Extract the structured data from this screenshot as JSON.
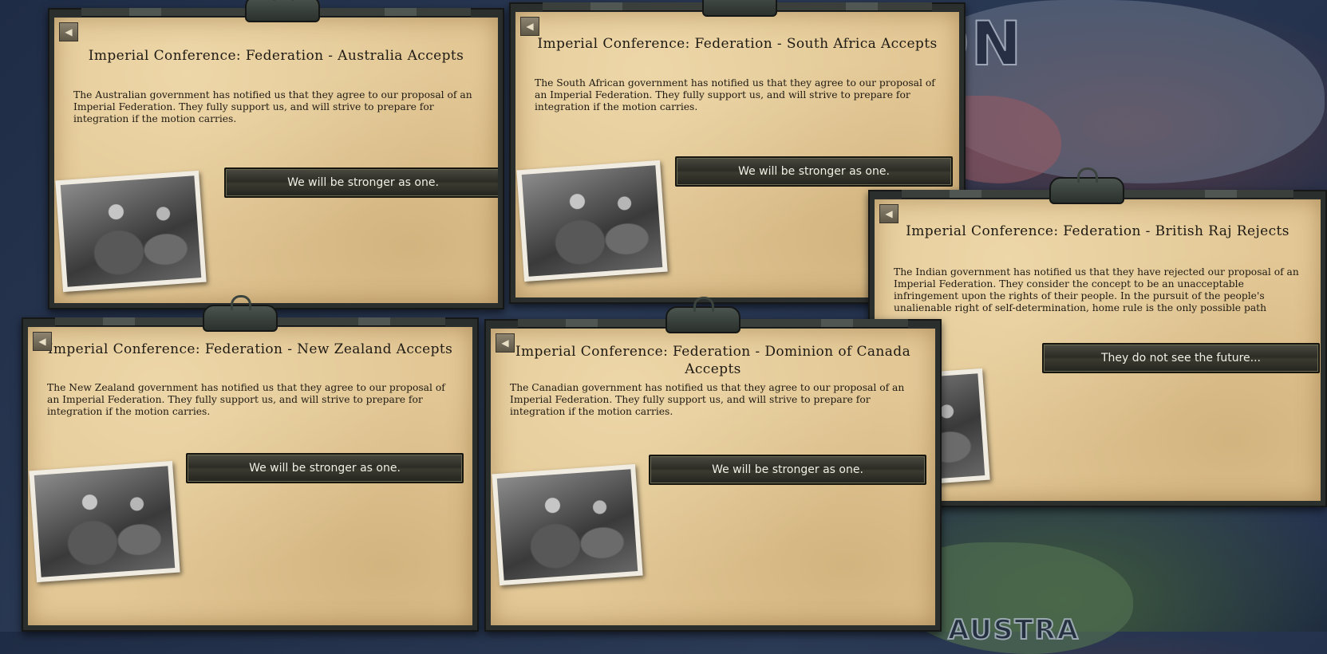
{
  "map": {
    "labels": [
      "ON",
      "AUSTRA"
    ]
  },
  "events": [
    {
      "title": "Imperial Conference: Federation - Australia Accepts",
      "description": "The Australian government has notified us that they agree to our proposal of an Imperial Federation. They fully support us, and will strive to prepare for integration if the motion carries.",
      "option": "We will be stronger as one."
    },
    {
      "title": "Imperial Conference: Federation - South Africa Accepts",
      "description": "The South African government has notified us that they agree to our proposal of an Imperial Federation. They fully support us, and will strive to prepare for integration if the motion carries.",
      "option": "We will be stronger as one."
    },
    {
      "title": "Imperial Conference: Federation - British Raj Rejects",
      "description": "The Indian government has notified us that they have rejected our proposal of an Imperial Federation. They consider the concept to be an unacceptable infringement upon the rights of their people. In the pursuit of the people's unalienable right of self-determination, home rule is the only possible path",
      "option": "They do not see the future..."
    },
    {
      "title": "Imperial Conference: Federation - New Zealand Accepts",
      "description": "The New Zealand government has notified us that they agree to our proposal of an Imperial Federation. They fully support us, and will strive to prepare for integration if the motion carries.",
      "option": "We will be stronger as one."
    },
    {
      "title": "Imperial Conference: Federation - Dominion of Canada Accepts",
      "description": "The Canadian government has notified us that they agree to our proposal of an Imperial Federation. They fully support us, and will strive to prepare for integration if the motion carries.",
      "option": "We will be stronger as one."
    }
  ]
}
